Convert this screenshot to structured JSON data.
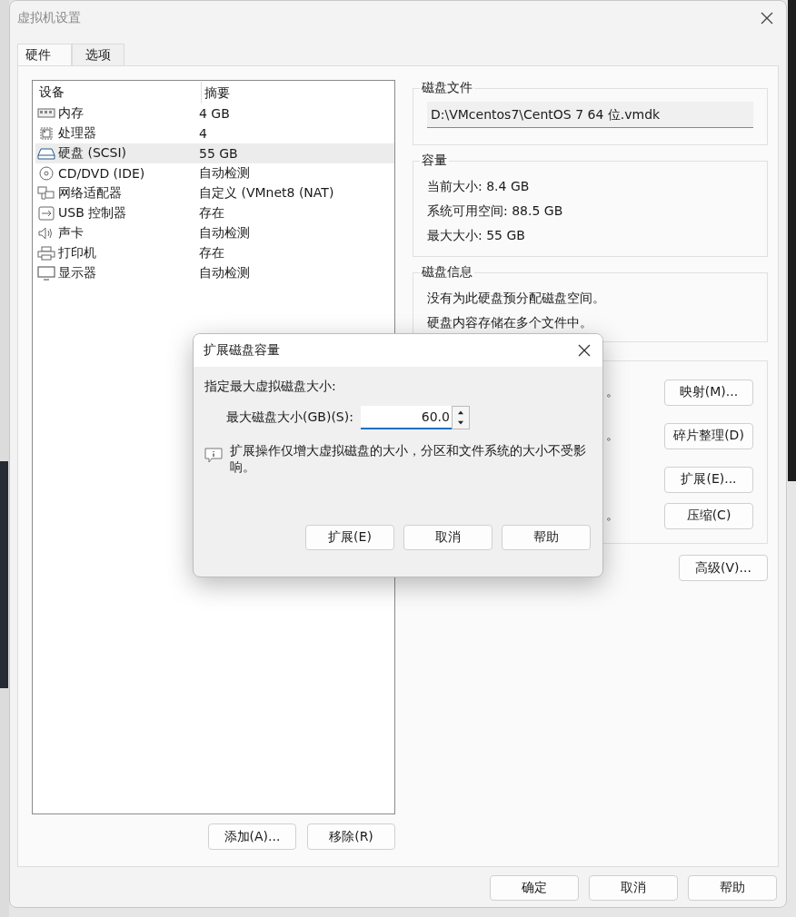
{
  "window": {
    "title": "虚拟机设置"
  },
  "tabs": [
    {
      "label": "硬件",
      "selected": true
    },
    {
      "label": "选项",
      "selected": false
    }
  ],
  "device_list": {
    "columns": [
      "设备",
      "摘要"
    ],
    "rows": [
      {
        "kind": "memory",
        "device": "内存",
        "summary": "4 GB",
        "selected": false
      },
      {
        "kind": "cpu",
        "device": "处理器",
        "summary": "4",
        "selected": false
      },
      {
        "kind": "disk",
        "device": "硬盘 (SCSI)",
        "summary": "55 GB",
        "selected": true
      },
      {
        "kind": "cd",
        "device": "CD/DVD (IDE)",
        "summary": "自动检测",
        "selected": false
      },
      {
        "kind": "network",
        "device": "网络适配器",
        "summary": "自定义 (VMnet8 (NAT)",
        "selected": false
      },
      {
        "kind": "usb",
        "device": "USB 控制器",
        "summary": "存在",
        "selected": false
      },
      {
        "kind": "sound",
        "device": "声卡",
        "summary": "自动检测",
        "selected": false
      },
      {
        "kind": "printer",
        "device": "打印机",
        "summary": "存在",
        "selected": false
      },
      {
        "kind": "display",
        "device": "显示器",
        "summary": "自动检测",
        "selected": false
      }
    ]
  },
  "list_buttons": [
    "添加(A)...",
    "移除(R)"
  ],
  "disk_file": {
    "title": "磁盘文件",
    "path": "D:\\VMcentos7\\CentOS 7 64 位.vmdk"
  },
  "capacity": {
    "title": "容量",
    "lines": [
      "当前大小: 8.4 GB",
      "系统可用空间: 88.5 GB",
      "最大大小: 55 GB"
    ]
  },
  "disk_info": {
    "title": "磁盘信息",
    "lines": [
      "没有为此硬盘预分配磁盘空间。",
      "硬盘内容存储在多个文件中。"
    ]
  },
  "utilities": [
    {
      "note": "。",
      "button": "映射(M)..."
    },
    {
      "note": "。",
      "button": "碎片整理(D)"
    },
    {
      "button": "扩展(E)..."
    },
    {
      "note": "。",
      "button": "压缩(C)"
    }
  ],
  "advanced_button": "高级(V)...",
  "footer_buttons": [
    "确定",
    "取消",
    "帮助"
  ],
  "dialog": {
    "title": "扩展磁盘容量",
    "prompt": "指定最大虚拟磁盘大小:",
    "size_label": "最大磁盘大小(GB)(S):",
    "size_value": "60.0",
    "info": "扩展操作仅增大虚拟磁盘的大小，分区和文件系统的大小不受影响。",
    "buttons": [
      "扩展(E)",
      "取消",
      "帮助"
    ]
  }
}
